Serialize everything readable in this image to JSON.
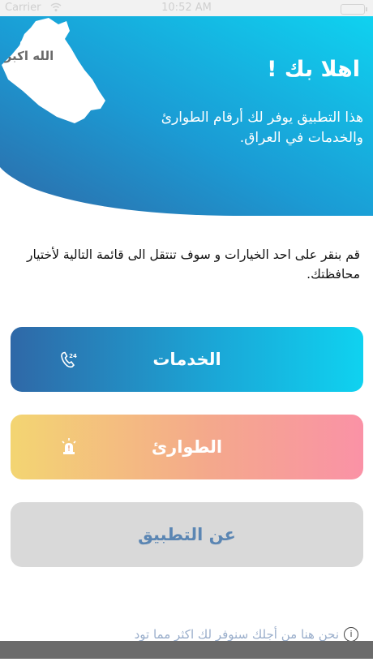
{
  "status_bar": {
    "carrier": "Carrier",
    "time": "10:52 AM"
  },
  "header": {
    "welcome": "اهلا بك !",
    "subtitle": "هذا التطبيق يوفر لك أرقام الطوارئ والخدمات في العراق.",
    "map_text": "الله اكبر",
    "gradient_colors": [
      "#0fd2f0",
      "#2e6aa8"
    ]
  },
  "instructions": "قم بنقر على احد الخيارات و سوف تنتقل الى قائمة التالية لأختيار محافظتك.",
  "buttons": {
    "services": {
      "label": "الخدمات",
      "icon": "phone-24-icon"
    },
    "emergency": {
      "label": "الطوارئ",
      "icon": "alarm-siren-icon"
    },
    "about": {
      "label": "عن التطبيق"
    }
  },
  "footer": {
    "text": "نحن هنا من أجلك سنوفر لك اكثر مما تود",
    "icon": "info-icon"
  }
}
